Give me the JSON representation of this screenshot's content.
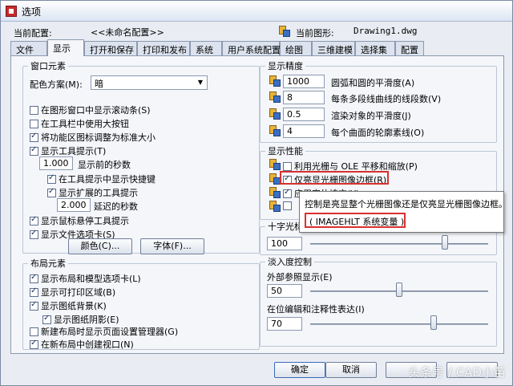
{
  "window": {
    "title": "选项"
  },
  "header": {
    "current_config_label": "当前配置:",
    "current_config_value": "<<未命名配置>>",
    "current_drawing_label": "当前图形:",
    "current_drawing_value": "Drawing1.dwg"
  },
  "tabs": [
    "文件",
    "显示",
    "打开和保存",
    "打印和发布",
    "系统",
    "用户系统配置",
    "绘图",
    "三维建模",
    "选择集",
    "配置"
  ],
  "window_elements": {
    "title": "窗口元素",
    "color_scheme_label": "配色方案(M):",
    "color_scheme_value": "暗",
    "checkboxes": [
      {
        "label": "在图形窗口中显示滚动条(S)",
        "checked": false
      },
      {
        "label": "在工具栏中使用大按钮",
        "checked": false
      },
      {
        "label": "将功能区图标调整为标准大小",
        "checked": true
      },
      {
        "label": "显示工具提示(T)",
        "checked": true
      }
    ],
    "delay_value": "1.000",
    "delay_label": "显示前的秒数",
    "show_shortcut": "在工具提示中显示快捷键",
    "show_extended": "显示扩展的工具提示",
    "ext_delay_value": "2.000",
    "ext_delay_label": "延迟的秒数",
    "show_rollover": "显示鼠标悬停工具提示",
    "show_file_tabs": "显示文件选项卡(S)",
    "color_button": "颜色(C)...",
    "font_button": "字体(F)..."
  },
  "layout_elements": {
    "title": "布局元素",
    "checkboxes": [
      {
        "label": "显示布局和模型选项卡(L)",
        "checked": true
      },
      {
        "label": "显示可打印区域(B)",
        "checked": true
      },
      {
        "label": "显示图纸背景(K)",
        "checked": true
      },
      {
        "label": "显示图纸阴影(E)",
        "checked": true
      },
      {
        "label": "新建布局时显示页面设置管理器(G)",
        "checked": false
      },
      {
        "label": "在新布局中创建视口(N)",
        "checked": true
      }
    ]
  },
  "display_resolution": {
    "title": "显示精度",
    "items": [
      {
        "value": "1000",
        "label": "圆弧和圆的平滑度(A)"
      },
      {
        "value": "8",
        "label": "每条多段线曲线的线段数(V)"
      },
      {
        "value": "0.5",
        "label": "渲染对象的平滑度(J)"
      },
      {
        "value": "4",
        "label": "每个曲面的轮廓素线(O)"
      }
    ]
  },
  "display_performance": {
    "title": "显示性能",
    "items": [
      {
        "label": "利用光栅与 OLE 平移和缩放(P)",
        "checked": false
      },
      {
        "label": "仅亮显光栅图像边框(R)",
        "checked": true
      },
      {
        "label": "应用实体填充(Y)",
        "checked": true
      }
    ]
  },
  "tooltip": {
    "line1": "控制是亮显整个光栅图像还是仅亮显光栅图像边框。",
    "line2": "( IMAGEHLT 系统变量 )"
  },
  "crosshair": {
    "title": "十字光标",
    "value": "100"
  },
  "fade": {
    "title": "淡入度控制",
    "xref_label": "外部参照显示(E)",
    "xref_value": "50",
    "xref_fraction": 0.5,
    "inplace_label": "在位编辑和注释性表达(I)",
    "inplace_value": "70",
    "inplace_fraction": 0.7
  },
  "buttons": {
    "ok": "确定",
    "cancel": "取消"
  },
  "watermark": "头条号 / CAD小苗"
}
